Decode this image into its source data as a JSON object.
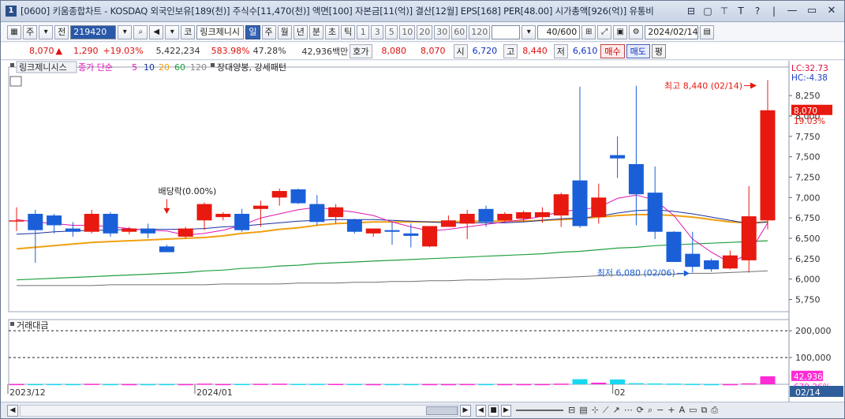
{
  "title": "[0600] 키움종합차트 - KOSDAQ 외국인보유[189(천)] 주식수[11,470(천)] 액면[100] 자본금[11(억)] 결산[12월] EPS[168] PER[48.00] 시가총액[926(억)] 유통비",
  "toolbar": {
    "period_unit": "주",
    "range": "전",
    "code": "219420",
    "stock_name": "링크제니시",
    "market": "코",
    "periods": [
      "일",
      "주",
      "월",
      "년",
      "분",
      "초",
      "틱"
    ],
    "active_period": "일",
    "intervals": [
      "1",
      "3",
      "5",
      "10",
      "20",
      "30",
      "60",
      "120"
    ],
    "count": "40/600",
    "date": "2024/02/14"
  },
  "quote": {
    "price": "8,070",
    "arrow": "▲",
    "change": "1,290",
    "change_pct": "+19.03%",
    "volume": "5,422,234",
    "vol_ratio": "583.98%",
    "turnover": "47.28%",
    "amount": "42,936백만",
    "hoga_label": "호가",
    "ask": "8,080",
    "bid": "8,070",
    "open_label": "시",
    "open": "6,720",
    "high_label": "고",
    "high": "8,440",
    "low_label": "저",
    "low": "6,610",
    "buy": "매수",
    "sell": "매도",
    "pyeong": "평"
  },
  "legend": {
    "stock": "링크제니시스",
    "ma_label": "종가 단순",
    "ma5": "5",
    "ma10": "10",
    "ma20": "20",
    "ma60": "60",
    "ma120": "120",
    "pattern": "장대양봉, 강세패턴"
  },
  "volume_title": "거래대금",
  "annotations": {
    "dividend": "배당락(0.00%)",
    "high": "최고 8,440 (02/14)",
    "low": "최저 6,080 (02/06)",
    "lc": "LC:32.73",
    "hc": "HC:-4.38",
    "last_price": "8,070",
    "last_pct": "19.03%",
    "last_vol": "42,936",
    "last_vol_pct": "679.26%"
  },
  "colors": {
    "up": "#e8190f",
    "down": "#1a5fd8",
    "ma5": "#e014b4",
    "ma10": "#1a2fa0",
    "ma20": "#f0a010",
    "ma60": "#21a040",
    "ma120": "#707070"
  },
  "chart_data": {
    "type": "candlestick",
    "price_ylim": [
      5600,
      8600
    ],
    "price_ticks": [
      "8,250",
      "8,000",
      "7,750",
      "7,500",
      "7,250",
      "7,000",
      "6,750",
      "6,500",
      "6,250",
      "6,000",
      "5,750"
    ],
    "volume_ticks": [
      "200,000",
      "100,000"
    ],
    "x_labels": [
      "2023/12",
      "2024/01",
      "02",
      "02/14"
    ],
    "candles": [
      {
        "o": 6720,
        "h": 6880,
        "l": 6590,
        "c": 6720
      },
      {
        "o": 6800,
        "h": 6850,
        "l": 6200,
        "c": 6600
      },
      {
        "o": 6780,
        "h": 6800,
        "l": 6560,
        "c": 6660
      },
      {
        "o": 6620,
        "h": 6700,
        "l": 6520,
        "c": 6580
      },
      {
        "o": 6580,
        "h": 6850,
        "l": 6560,
        "c": 6800
      },
      {
        "o": 6800,
        "h": 6820,
        "l": 6520,
        "c": 6560
      },
      {
        "o": 6580,
        "h": 6640,
        "l": 6550,
        "c": 6620
      },
      {
        "o": 6620,
        "h": 6680,
        "l": 6500,
        "c": 6560
      },
      {
        "o": 6400,
        "h": 6420,
        "l": 6330,
        "c": 6330
      },
      {
        "o": 6520,
        "h": 6640,
        "l": 6500,
        "c": 6620
      },
      {
        "o": 6720,
        "h": 6940,
        "l": 6600,
        "c": 6920
      },
      {
        "o": 6760,
        "h": 6820,
        "l": 6720,
        "c": 6800
      },
      {
        "o": 6800,
        "h": 6860,
        "l": 6580,
        "c": 6600
      },
      {
        "o": 6860,
        "h": 6960,
        "l": 6640,
        "c": 6900
      },
      {
        "o": 7000,
        "h": 7110,
        "l": 6900,
        "c": 7080
      },
      {
        "o": 7100,
        "h": 7110,
        "l": 6920,
        "c": 6930
      },
      {
        "o": 6920,
        "h": 7030,
        "l": 6660,
        "c": 6700
      },
      {
        "o": 6760,
        "h": 6920,
        "l": 6680,
        "c": 6880
      },
      {
        "o": 6730,
        "h": 6740,
        "l": 6560,
        "c": 6580
      },
      {
        "o": 6560,
        "h": 6620,
        "l": 6520,
        "c": 6620
      },
      {
        "o": 6600,
        "h": 6700,
        "l": 6420,
        "c": 6580
      },
      {
        "o": 6560,
        "h": 6680,
        "l": 6390,
        "c": 6530
      },
      {
        "o": 6400,
        "h": 6450,
        "l": 6390,
        "c": 6650
      },
      {
        "o": 6640,
        "h": 6780,
        "l": 6640,
        "c": 6720
      },
      {
        "o": 6680,
        "h": 6850,
        "l": 6490,
        "c": 6800
      },
      {
        "o": 6860,
        "h": 6900,
        "l": 6640,
        "c": 6700
      },
      {
        "o": 6720,
        "h": 6820,
        "l": 6700,
        "c": 6800
      },
      {
        "o": 6740,
        "h": 6840,
        "l": 6700,
        "c": 6820
      },
      {
        "o": 6760,
        "h": 6880,
        "l": 6690,
        "c": 6820
      },
      {
        "o": 6780,
        "h": 7060,
        "l": 6640,
        "c": 7040
      },
      {
        "o": 7210,
        "h": 8360,
        "l": 6630,
        "c": 6650
      },
      {
        "o": 6760,
        "h": 7170,
        "l": 6680,
        "c": 7000
      },
      {
        "o": 7520,
        "h": 7750,
        "l": 7240,
        "c": 7480
      },
      {
        "o": 7410,
        "h": 8370,
        "l": 6660,
        "c": 7040
      },
      {
        "o": 7060,
        "h": 7380,
        "l": 6490,
        "c": 6580
      },
      {
        "o": 6580,
        "h": 6590,
        "l": 6210,
        "c": 6210
      },
      {
        "o": 6310,
        "h": 6580,
        "l": 6080,
        "c": 6150
      },
      {
        "o": 6230,
        "h": 6250,
        "l": 6090,
        "c": 6120
      },
      {
        "o": 6130,
        "h": 6350,
        "l": 6120,
        "c": 6290
      },
      {
        "o": 6230,
        "h": 7140,
        "l": 6080,
        "c": 6770
      },
      {
        "o": 6720,
        "h": 8440,
        "l": 6610,
        "c": 8070
      }
    ],
    "ma5": [
      6730,
      6700,
      6680,
      6660,
      6660,
      6640,
      6620,
      6600,
      6590,
      6540,
      6560,
      6600,
      6660,
      6750,
      6800,
      6850,
      6880,
      6850,
      6820,
      6780,
      6700,
      6640,
      6590,
      6610,
      6640,
      6670,
      6700,
      6730,
      6770,
      6830,
      6850,
      6880,
      6990,
      7030,
      6970,
      6780,
      6490,
      6330,
      6200,
      6310,
      6690
    ],
    "ma10": [
      6550,
      6560,
      6580,
      6590,
      6600,
      6600,
      6610,
      6610,
      6610,
      6610,
      6620,
      6640,
      6650,
      6670,
      6690,
      6710,
      6720,
      6730,
      6730,
      6730,
      6720,
      6710,
      6700,
      6690,
      6690,
      6690,
      6690,
      6700,
      6720,
      6740,
      6750,
      6770,
      6810,
      6840,
      6850,
      6830,
      6800,
      6760,
      6720,
      6680,
      6700
    ],
    "ma20": [
      6370,
      6390,
      6410,
      6430,
      6450,
      6460,
      6470,
      6480,
      6490,
      6500,
      6510,
      6530,
      6560,
      6580,
      6610,
      6630,
      6660,
      6680,
      6690,
      6700,
      6700,
      6700,
      6700,
      6700,
      6710,
      6710,
      6710,
      6710,
      6720,
      6730,
      6740,
      6760,
      6780,
      6790,
      6790,
      6780,
      6760,
      6730,
      6700,
      6690,
      6700
    ],
    "ma60": [
      5990,
      6000,
      6010,
      6020,
      6030,
      6040,
      6050,
      6060,
      6070,
      6080,
      6100,
      6110,
      6130,
      6140,
      6160,
      6170,
      6190,
      6200,
      6210,
      6220,
      6230,
      6240,
      6250,
      6260,
      6270,
      6280,
      6290,
      6300,
      6310,
      6330,
      6340,
      6360,
      6380,
      6390,
      6410,
      6420,
      6430,
      6440,
      6450,
      6460,
      6470
    ],
    "ma120": [
      5920,
      5920,
      5920,
      5920,
      5920,
      5930,
      5930,
      5930,
      5930,
      5930,
      5930,
      5940,
      5940,
      5940,
      5940,
      5950,
      5950,
      5950,
      5960,
      5960,
      5970,
      5970,
      5980,
      5980,
      5990,
      5990,
      6000,
      6000,
      6010,
      6020,
      6030,
      6040,
      6050,
      6050,
      6060,
      6060,
      6070,
      6070,
      6080,
      6090,
      6100
    ],
    "volume_ylim": [
      0,
      230000
    ],
    "volume": [
      1200,
      1000,
      1100,
      900,
      1800,
      900,
      800,
      800,
      1000,
      900,
      2500,
      1100,
      1400,
      1800,
      2200,
      1500,
      1700,
      1500,
      1300,
      800,
      900,
      900,
      1000,
      800,
      1200,
      1000,
      900,
      900,
      1000,
      2400,
      19000,
      6000,
      18000,
      4000,
      3000,
      2500,
      1700,
      800,
      700,
      3500,
      30000
    ]
  }
}
